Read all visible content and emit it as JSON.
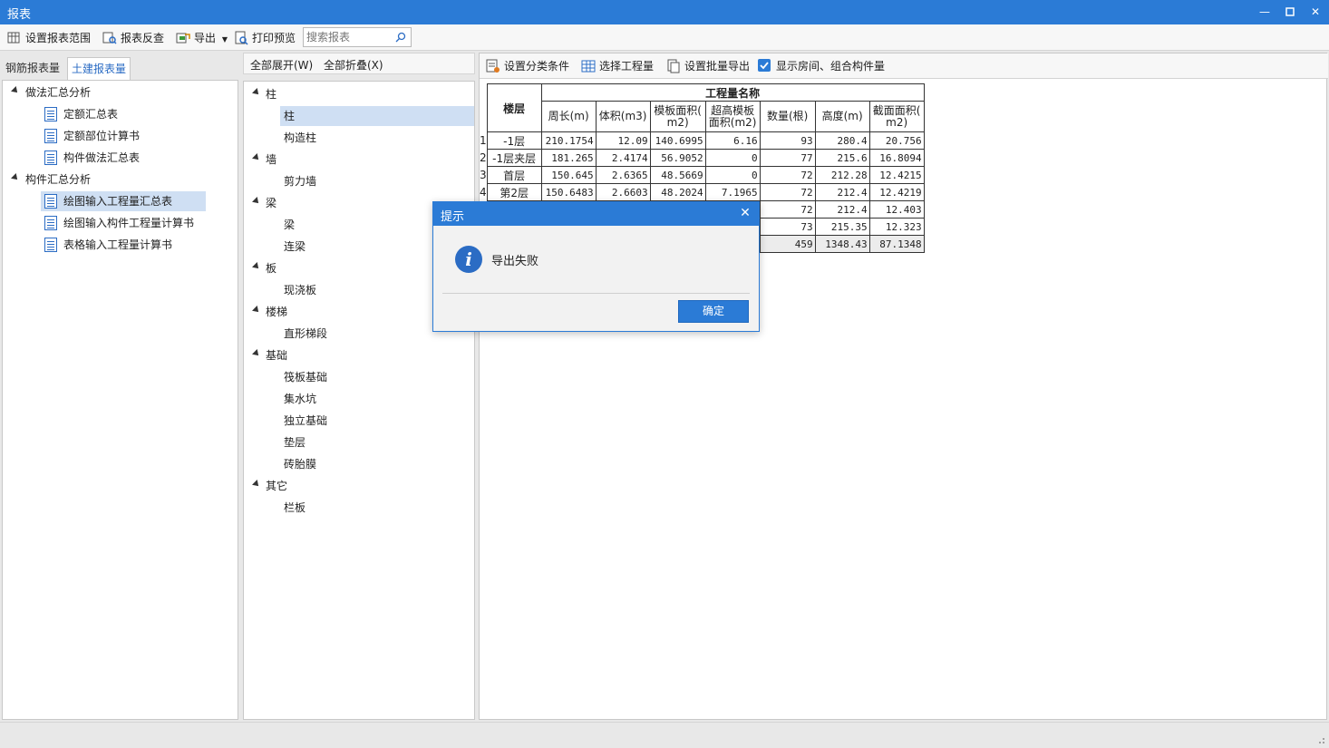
{
  "window": {
    "title": "报表"
  },
  "toolbar": {
    "set_range": "设置报表范围",
    "reverse_check": "报表反查",
    "export": "导出",
    "print_preview": "打印预览",
    "search_placeholder": "搜索报表"
  },
  "left_tabs": {
    "rebar": "钢筋报表量",
    "civil": "土建报表量"
  },
  "left_tree": {
    "group1": "做法汇总分析",
    "g1_items": [
      "定额汇总表",
      "定额部位计算书",
      "构件做法汇总表"
    ],
    "group2": "构件汇总分析",
    "g2_items": [
      "绘图输入工程量汇总表",
      "绘图输入构件工程量计算书",
      "表格输入工程量计算书"
    ]
  },
  "mid_toolbar": {
    "expand_all": "全部展开(W)",
    "collapse_all": "全部折叠(X)"
  },
  "mid_tree": {
    "g_zhu": "柱",
    "zhu": "柱",
    "gouzaozhu": "构造柱",
    "g_qiang": "墙",
    "jianliqiang": "剪力墙",
    "g_liang": "梁",
    "liang": "梁",
    "lianliang": "连梁",
    "g_ban": "板",
    "xianjiaoban": "现浇板",
    "g_louti": "楼梯",
    "zhixingtiduan": "直形梯段",
    "g_jichu": "基础",
    "fabanjichu": "筏板基础",
    "jishuikeng": "集水坑",
    "dulijichu": "独立基础",
    "dianceng": "垫层",
    "zhuantaimo": "砖胎膜",
    "g_qita": "其它",
    "lanban": "栏板"
  },
  "right_toolbar": {
    "set_classify": "设置分类条件",
    "select_quantity": "选择工程量",
    "batch_export": "设置批量导出",
    "show_rooms": "显示房间、组合构件量"
  },
  "table": {
    "floor_header": "楼层",
    "group_header": "工程量名称",
    "cols": [
      "周长(m)",
      "体积(m3)",
      "模板面积(\nm2)",
      "超高模板\n面积(m2)",
      "数量(根)",
      "高度(m)",
      "截面面积(\nm2)"
    ],
    "rows": [
      {
        "n": "1",
        "floor": "-1层",
        "v": [
          "210.1754",
          "12.09",
          "140.6995",
          "6.16",
          "93",
          "280.4",
          "20.756"
        ]
      },
      {
        "n": "2",
        "floor": "-1层夹层",
        "v": [
          "181.265",
          "2.4174",
          "56.9052",
          "0",
          "77",
          "215.6",
          "16.8094"
        ]
      },
      {
        "n": "3",
        "floor": "首层",
        "v": [
          "150.645",
          "2.6365",
          "48.5669",
          "0",
          "72",
          "212.28",
          "12.4215"
        ]
      },
      {
        "n": "4",
        "floor": "第2层",
        "v": [
          "150.6483",
          "2.6603",
          "48.2024",
          "7.1965",
          "72",
          "212.4",
          "12.4219"
        ]
      },
      {
        "n": "",
        "floor": "",
        "v": [
          "",
          "",
          "",
          "",
          "72",
          "212.4",
          "12.403"
        ]
      },
      {
        "n": "",
        "floor": "",
        "v": [
          "",
          "",
          "",
          "",
          "73",
          "215.35",
          "12.323"
        ]
      },
      {
        "n": "",
        "floor": "",
        "v": [
          "",
          "",
          "",
          "",
          "459",
          "1348.43",
          "87.1348"
        ]
      }
    ]
  },
  "dialog": {
    "title": "提示",
    "message": "导出失败",
    "ok": "确定"
  }
}
